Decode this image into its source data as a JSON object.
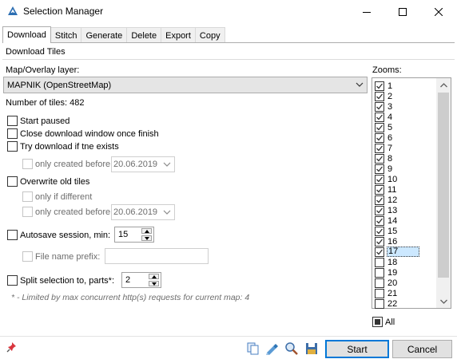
{
  "window": {
    "title": "Selection Manager",
    "icon": "josm-logo-icon"
  },
  "tabs": [
    {
      "label": "Download",
      "active": true
    },
    {
      "label": "Stitch"
    },
    {
      "label": "Generate"
    },
    {
      "label": "Delete"
    },
    {
      "label": "Export"
    },
    {
      "label": "Copy"
    }
  ],
  "download": {
    "section_title": "Download Tiles",
    "map_label": "Map/Overlay layer:",
    "map_value": "MAPNIK (OpenStreetMap)",
    "tiles_label": "Number of tiles: 482",
    "start_paused": {
      "label": "Start paused",
      "checked": false
    },
    "close_window": {
      "label": "Close download window once finish",
      "checked": false
    },
    "try_download": {
      "label": "Try download if tne exists",
      "checked": false
    },
    "only_created_before_1": {
      "label": "only created before",
      "date": "20.06.2019",
      "enabled": false
    },
    "overwrite": {
      "label": "Overwrite old tiles",
      "checked": false
    },
    "only_if_different": {
      "label": "only if different",
      "enabled": false
    },
    "only_created_before_2": {
      "label": "only created before",
      "date": "20.06.2019",
      "enabled": false
    },
    "autosave": {
      "label": "Autosave session, min:",
      "value": "15",
      "checked": false
    },
    "file_prefix": {
      "label": "File name prefix:",
      "value": "",
      "enabled": false
    },
    "split": {
      "label": "Split selection to, parts*:",
      "value": "2",
      "checked": false
    },
    "note": "* - Limited by max concurrent http(s) requests for current map: 4"
  },
  "zooms": {
    "label": "Zooms:",
    "items": [
      {
        "label": "1",
        "checked": true
      },
      {
        "label": "2",
        "checked": true
      },
      {
        "label": "3",
        "checked": true
      },
      {
        "label": "4",
        "checked": true
      },
      {
        "label": "5",
        "checked": true
      },
      {
        "label": "6",
        "checked": true
      },
      {
        "label": "7",
        "checked": true
      },
      {
        "label": "8",
        "checked": true
      },
      {
        "label": "9",
        "checked": true
      },
      {
        "label": "10",
        "checked": true
      },
      {
        "label": "11",
        "checked": true
      },
      {
        "label": "12",
        "checked": true
      },
      {
        "label": "13",
        "checked": true
      },
      {
        "label": "14",
        "checked": true
      },
      {
        "label": "15",
        "checked": true
      },
      {
        "label": "16",
        "checked": true
      },
      {
        "label": "17",
        "checked": true,
        "selected": true
      },
      {
        "label": "18",
        "checked": false
      },
      {
        "label": "19",
        "checked": false
      },
      {
        "label": "20",
        "checked": false
      },
      {
        "label": "21",
        "checked": false
      },
      {
        "label": "22",
        "checked": false
      }
    ],
    "all_label": "All"
  },
  "footer": {
    "icons": [
      "pin-icon",
      "copy-icon",
      "selection-tool-icon",
      "zoom-search-icon",
      "save-icon"
    ],
    "start_label": "Start",
    "cancel_label": "Cancel"
  },
  "colors": {
    "accent": "#0078d7",
    "check": "#333333",
    "selection": "#cce8ff"
  }
}
